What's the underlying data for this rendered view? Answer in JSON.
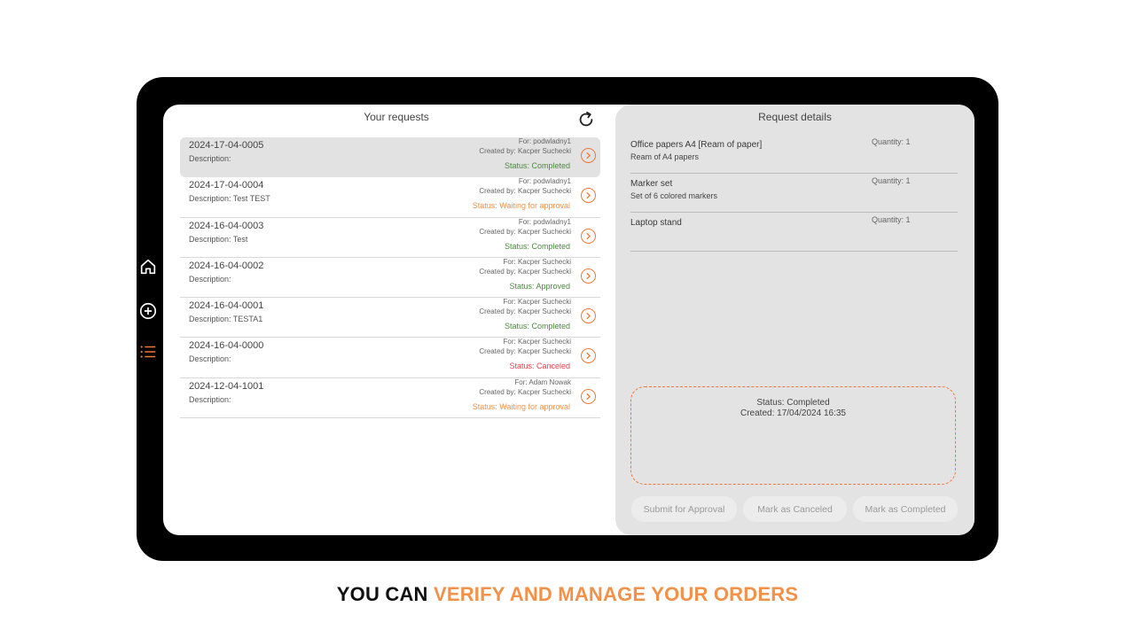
{
  "colors": {
    "accent": "#f07838",
    "status_completed": "#4a8a3c",
    "status_waiting": "#f29149",
    "status_approved": "#4a8a3c",
    "status_canceled": "#e8404a"
  },
  "nav": {
    "items": [
      {
        "icon": "home-icon"
      },
      {
        "icon": "add-circle-icon"
      },
      {
        "icon": "list-icon",
        "active": true
      }
    ]
  },
  "requests_panel": {
    "title": "Your requests",
    "refresh_icon": "refresh-icon",
    "items": [
      {
        "id": "2024-17-04-0005",
        "description": "Description:",
        "for": "For: podwladny1",
        "created_by": "Created by: Kacper Suchecki",
        "status": "Status: Completed",
        "status_kind": "completed",
        "selected": true
      },
      {
        "id": "2024-17-04-0004",
        "description": "Description: Test TEST",
        "for": "For: podwladny1",
        "created_by": "Created by: Kacper Suchecki",
        "status": "Status: Waiting for approval",
        "status_kind": "waiting"
      },
      {
        "id": "2024-16-04-0003",
        "description": "Description: Test",
        "for": "For: podwladny1",
        "created_by": "Created by: Kacper Suchecki",
        "status": "Status: Completed",
        "status_kind": "completed"
      },
      {
        "id": "2024-16-04-0002",
        "description": "Description:",
        "for": "For: Kacper Suchecki",
        "created_by": "Created by: Kacper Suchecki",
        "status": "Status: Approved",
        "status_kind": "approved"
      },
      {
        "id": "2024-16-04-0001",
        "description": "Description: TESTA1",
        "for": "For: Kacper Suchecki",
        "created_by": "Created by: Kacper Suchecki",
        "status": "Status: Completed",
        "status_kind": "completed"
      },
      {
        "id": "2024-16-04-0000",
        "description": "Description:",
        "for": "For: Kacper Suchecki",
        "created_by": "Created by: Kacper Suchecki",
        "status": "Status: Canceled",
        "status_kind": "canceled"
      },
      {
        "id": "2024-12-04-1001",
        "description": "Description:",
        "for": "For: Adam Nowak",
        "created_by": "Created by: Kacper Suchecki",
        "status": "Status: Waiting for approval",
        "status_kind": "waiting"
      }
    ]
  },
  "details_panel": {
    "title": "Request details",
    "items": [
      {
        "name": "Office papers A4 [Ream of paper]",
        "description": "Ream of A4 papers",
        "quantity": "Quantity: 1"
      },
      {
        "name": "Marker set",
        "description": "Set of 6 colored markers",
        "quantity": "Quantity: 1"
      },
      {
        "name": "Laptop stand",
        "description": "",
        "quantity": "Quantity: 1"
      }
    ],
    "status_text": "Status: Completed",
    "created_text": "Created: 17/04/2024 16:35",
    "buttons": {
      "submit": "Submit for Approval",
      "cancel": "Mark as Canceled",
      "complete": "Mark as Completed"
    }
  },
  "caption": {
    "part1": "YOU CAN ",
    "part2": "VERIFY AND MANAGE YOUR ORDERS"
  }
}
